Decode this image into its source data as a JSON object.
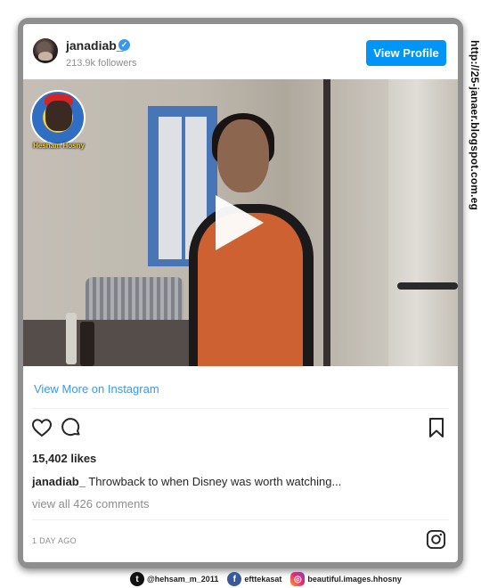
{
  "post": {
    "username": "janadiab_",
    "followers": "213.9k followers",
    "view_profile_label": "View Profile",
    "view_more_label": "View More on Instagram",
    "likes": "15,402 likes",
    "caption_user": "janadiab_",
    "caption_text": "Throwback to when Disney was worth watching...",
    "comments": "view all 426 comments",
    "timestamp": "1 DAY AGO"
  },
  "watermark": {
    "logo_text": "Hesham Hosny",
    "url": "http://25-janaer.blogspot.com.eg"
  },
  "social": {
    "twitter": "@hehsam_m_2011",
    "facebook": "efttekasat",
    "instagram": "beautiful.images.hhosny"
  },
  "colors": {
    "accent": "#0095f6",
    "link": "#3897f0"
  }
}
